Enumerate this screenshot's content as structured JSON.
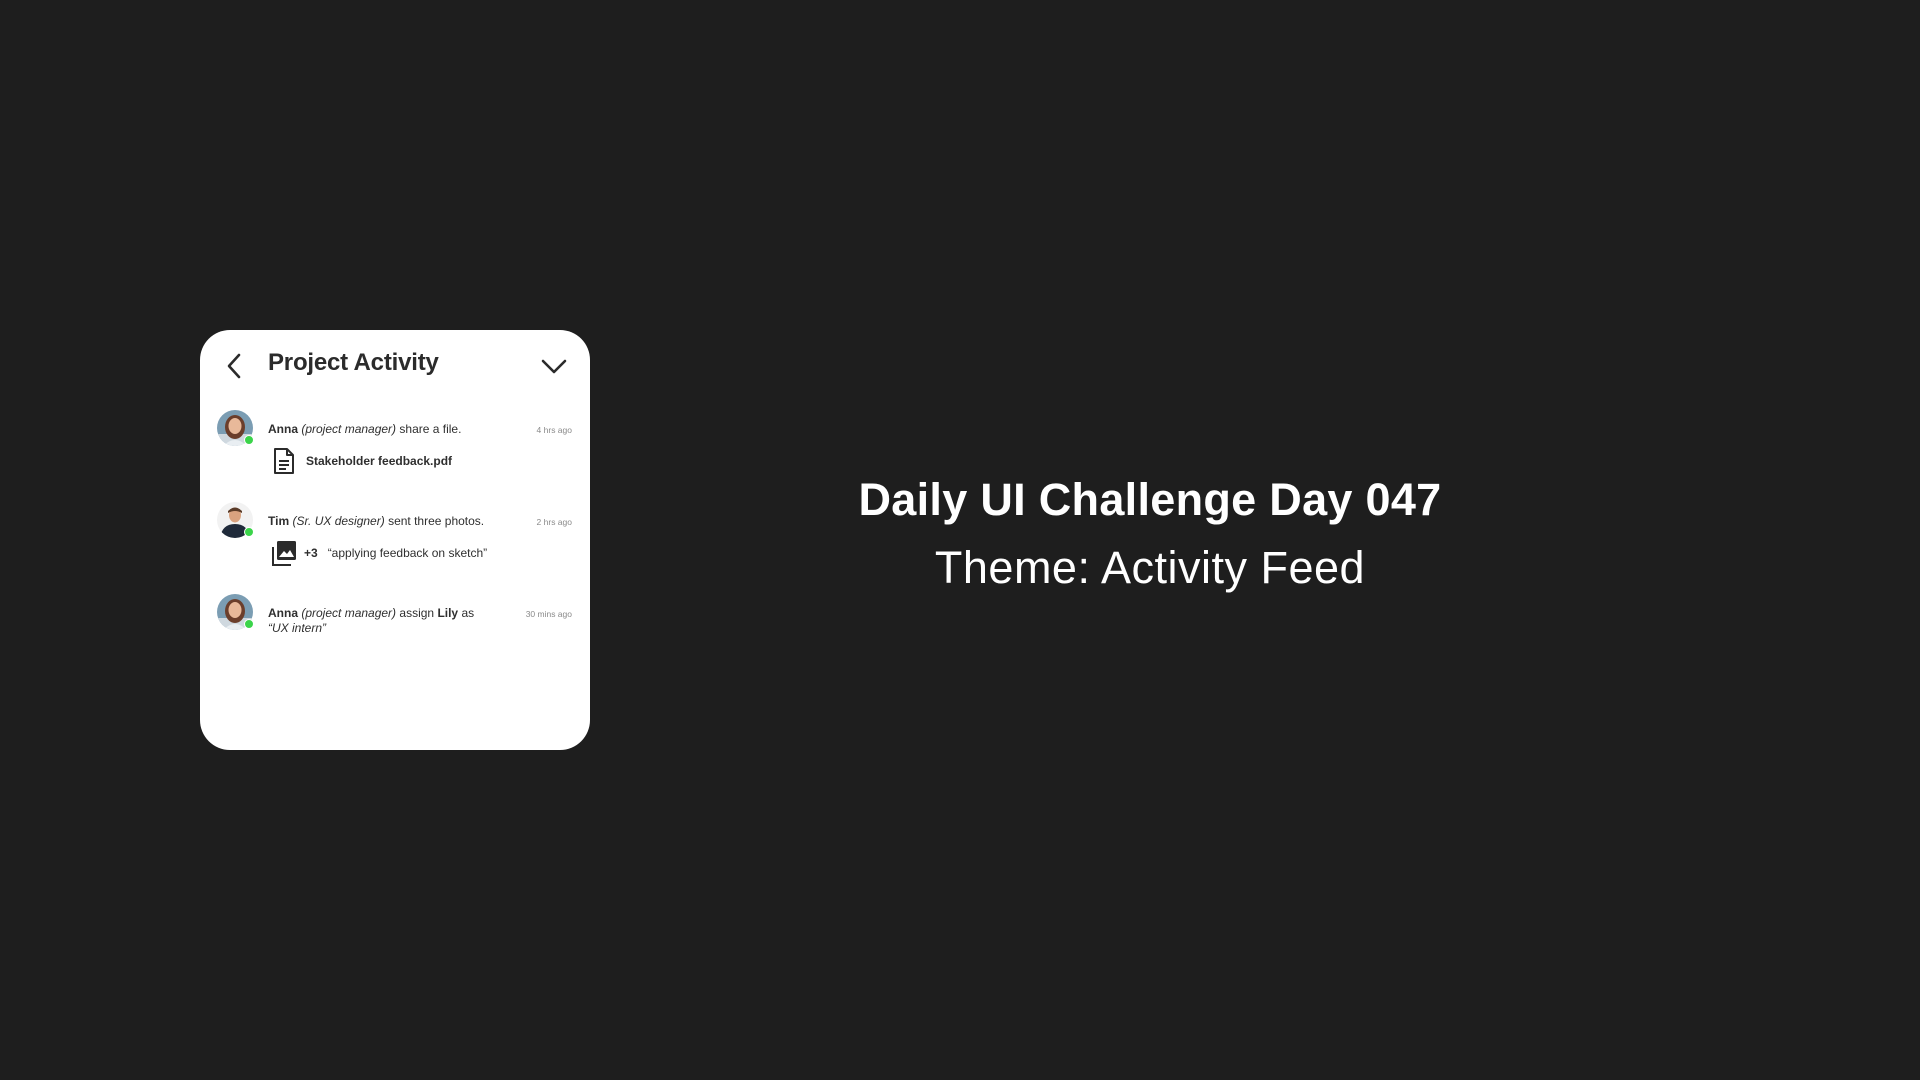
{
  "card": {
    "title": "Project Activity",
    "back_icon": "chevron-left-icon",
    "dropdown_icon": "chevron-down-icon"
  },
  "feed": [
    {
      "user": "Anna",
      "role": "(project manager)",
      "action": "share a file.",
      "time": "4 hrs ago",
      "online": true,
      "attachment": {
        "icon": "file-icon",
        "name": "Stakeholder feedback.pdf"
      }
    },
    {
      "user": "Tim",
      "role": "(Sr. UX designer)",
      "action": "sent three photos.",
      "time": "2 hrs ago",
      "online": true,
      "attachment": {
        "icon": "photo-library-icon",
        "count": "+3",
        "caption": "“applying feedback on sketch”"
      }
    },
    {
      "user": "Anna",
      "role": "(project manager)",
      "action": "assign",
      "assignee": "Lily",
      "connector": "as",
      "assigned_role": "“UX intern”",
      "time": "30 mins ago",
      "online": true
    }
  ],
  "headline": {
    "title": "Daily UI Challenge Day 047",
    "subtitle": "Theme: Activity Feed"
  },
  "colors": {
    "background": "#1e1e1e",
    "card": "#ffffff",
    "online": "#3bd44a",
    "text": "#2f2f2f",
    "muted": "#8a8a8a"
  }
}
